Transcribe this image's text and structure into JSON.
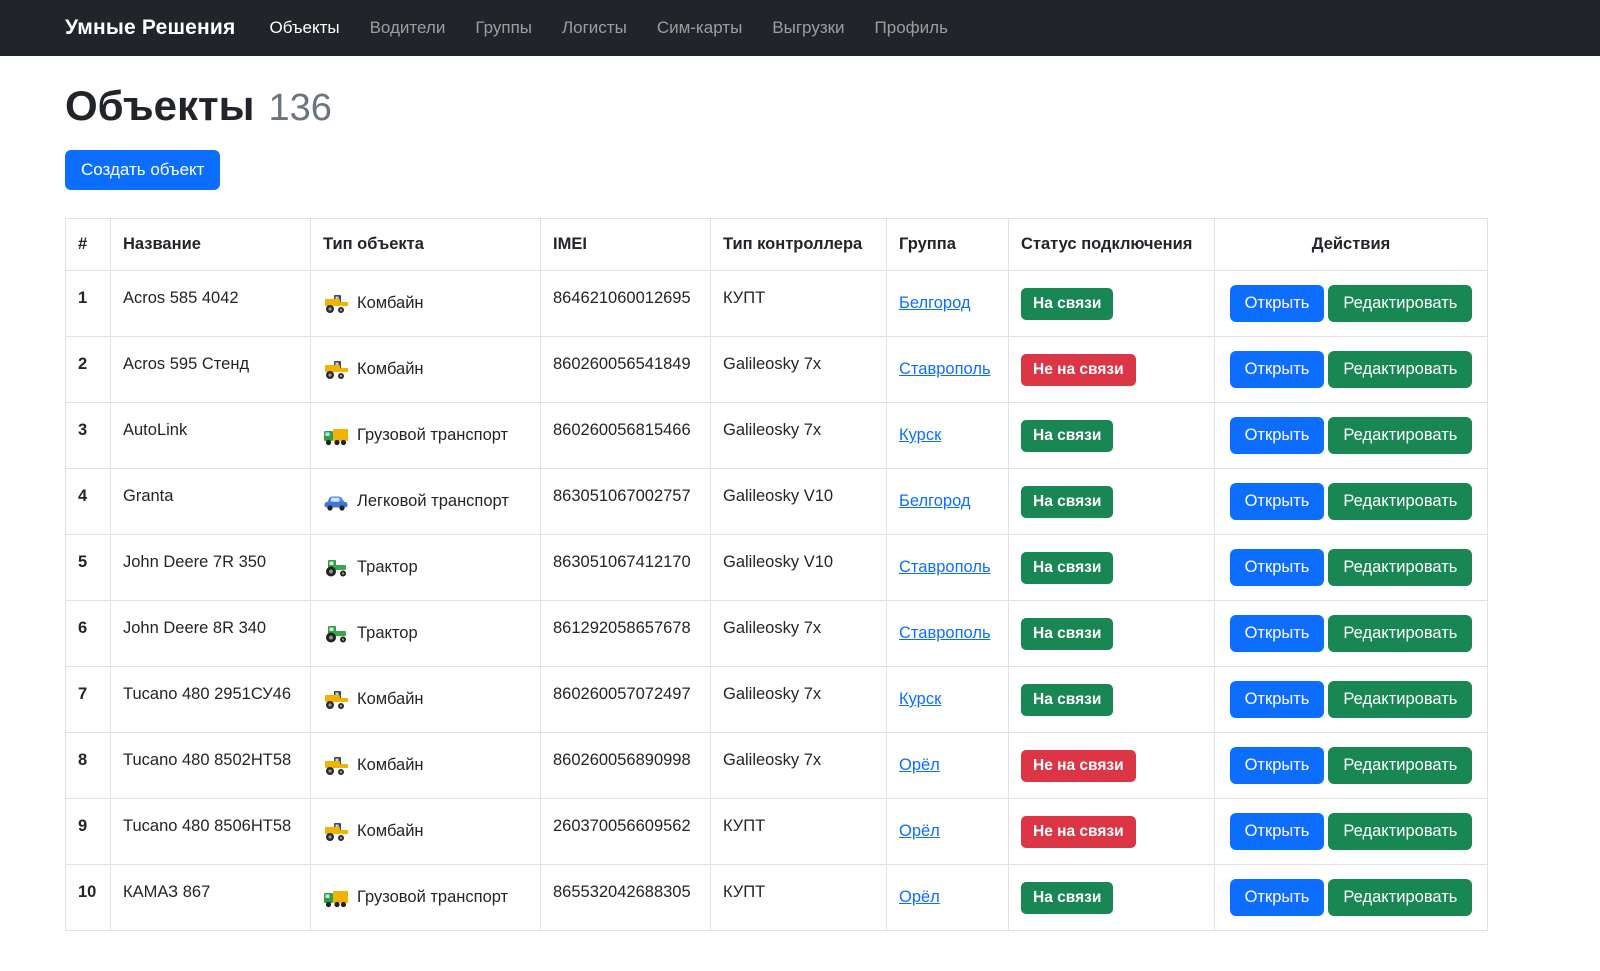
{
  "navbar": {
    "brand": "Умные Решения",
    "items": [
      {
        "key": "objects",
        "label": "Объекты",
        "active": true
      },
      {
        "key": "drivers",
        "label": "Водители",
        "active": false
      },
      {
        "key": "groups",
        "label": "Группы",
        "active": false
      },
      {
        "key": "logists",
        "label": "Логисты",
        "active": false
      },
      {
        "key": "simcards",
        "label": "Сим-карты",
        "active": false
      },
      {
        "key": "uploads",
        "label": "Выгрузки",
        "active": false
      },
      {
        "key": "profile",
        "label": "Профиль",
        "active": false
      }
    ]
  },
  "page": {
    "title": "Объекты",
    "count": "136",
    "create_button": "Создать объект"
  },
  "table": {
    "headers": [
      "#",
      "Название",
      "Тип объекта",
      "IMEI",
      "Тип контроллера",
      "Группа",
      "Статус подключения",
      "Действия"
    ],
    "action_labels": {
      "open": "Открыть",
      "edit": "Редактировать"
    },
    "status_colors": {
      "online": "#198754",
      "offline": "#dc3545"
    },
    "rows": [
      {
        "num": "1",
        "name": "Acros 585 4042",
        "icon": "combine-icon",
        "type": "Комбайн",
        "imei": "864621060012695",
        "controller": "КУПТ",
        "group": "Белгород",
        "status": "online",
        "status_label": "На связи"
      },
      {
        "num": "2",
        "name": "Acros 595 Стенд",
        "icon": "combine-icon",
        "type": "Комбайн",
        "imei": "860260056541849",
        "controller": "Galileosky 7x",
        "group": "Ставрополь",
        "status": "offline",
        "status_label": "Не на связи"
      },
      {
        "num": "3",
        "name": "AutoLink",
        "icon": "truck-icon",
        "type": "Грузовой транспорт",
        "imei": "860260056815466",
        "controller": "Galileosky 7x",
        "group": "Курск",
        "status": "online",
        "status_label": "На связи"
      },
      {
        "num": "4",
        "name": "Granta",
        "icon": "car-icon",
        "type": "Легковой транспорт",
        "imei": "863051067002757",
        "controller": "Galileosky V10",
        "group": "Белгород",
        "status": "online",
        "status_label": "На связи"
      },
      {
        "num": "5",
        "name": "John Deere 7R 350",
        "icon": "tractor-icon",
        "type": "Трактор",
        "imei": "863051067412170",
        "controller": "Galileosky V10",
        "group": "Ставрополь",
        "status": "online",
        "status_label": "На связи"
      },
      {
        "num": "6",
        "name": "John Deere 8R 340",
        "icon": "tractor-icon",
        "type": "Трактор",
        "imei": "861292058657678",
        "controller": "Galileosky 7x",
        "group": "Ставрополь",
        "status": "online",
        "status_label": "На связи"
      },
      {
        "num": "7",
        "name": "Tucano 480 2951СУ46",
        "icon": "combine-icon",
        "type": "Комбайн",
        "imei": "860260057072497",
        "controller": "Galileosky 7x",
        "group": "Курск",
        "status": "online",
        "status_label": "На связи"
      },
      {
        "num": "8",
        "name": "Tucano 480 8502НТ58",
        "icon": "combine-icon",
        "type": "Комбайн",
        "imei": "860260056890998",
        "controller": "Galileosky 7x",
        "group": "Орёл",
        "status": "offline",
        "status_label": "Не на связи"
      },
      {
        "num": "9",
        "name": "Tucano 480 8506НТ58",
        "icon": "combine-icon",
        "type": "Комбайн",
        "imei": "260370056609562",
        "controller": "КУПТ",
        "group": "Орёл",
        "status": "offline",
        "status_label": "Не на связи"
      },
      {
        "num": "10",
        "name": "КАМАЗ 867",
        "icon": "truck-icon",
        "type": "Грузовой транспорт",
        "imei": "865532042688305",
        "controller": "КУПТ",
        "group": "Орёл",
        "status": "online",
        "status_label": "На связи"
      }
    ]
  }
}
